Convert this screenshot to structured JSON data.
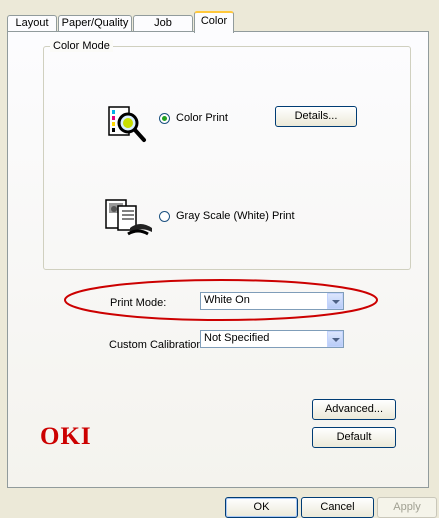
{
  "tabs": [
    {
      "label": "Layout"
    },
    {
      "label": "Paper/Quality"
    },
    {
      "label": "Job Options"
    },
    {
      "label": "Color",
      "active": true
    }
  ],
  "color_mode": {
    "title": "Color Mode",
    "options": [
      {
        "label": "Color Print",
        "selected": true,
        "icon": "color-print-magnifier-icon"
      },
      {
        "label": "Gray Scale (White) Print",
        "selected": false,
        "icon": "grayscale-print-icon"
      }
    ],
    "details_label": "Details..."
  },
  "print_mode": {
    "label": "Print Mode:",
    "value": "White On"
  },
  "custom_calibration": {
    "label": "Custom Calibration:",
    "value": "Not Specified"
  },
  "buttons": {
    "advanced": "Advanced...",
    "default": "Default",
    "ok": "OK",
    "cancel": "Cancel",
    "apply": "Apply"
  },
  "brand": {
    "logo_text": "OKI",
    "color": "#cc0000"
  },
  "annotation": {
    "highlight_color": "#cc0000"
  }
}
